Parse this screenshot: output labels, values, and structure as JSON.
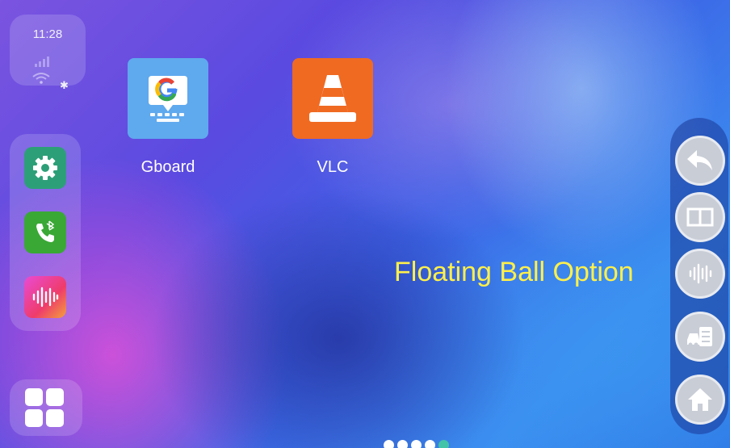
{
  "status": {
    "time": "11:28",
    "signal_icon": "signal-bars-icon",
    "wifi_icon": "wifi-icon",
    "bluetooth_icon": "bluetooth-icon"
  },
  "dock": {
    "items": [
      {
        "name": "settings",
        "icon": "gear-icon",
        "color": "#2d9f78"
      },
      {
        "name": "bluetooth-phone",
        "icon": "phone-bluetooth-icon",
        "color": "#3aa835"
      },
      {
        "name": "audio",
        "icon": "sound-wave-icon",
        "color": "#e94bd4"
      }
    ],
    "app_drawer_icon": "grid-icon"
  },
  "apps": [
    {
      "label": "Gboard",
      "icon": "gboard-icon",
      "color": "#5fa9ee"
    },
    {
      "label": "VLC",
      "icon": "vlc-cone-icon",
      "color": "#f06a22"
    }
  ],
  "caption": "Floating Ball Option",
  "floating_ball": {
    "buttons": [
      {
        "name": "back",
        "icon": "back-arrow-icon"
      },
      {
        "name": "split-screen",
        "icon": "split-screen-icon"
      },
      {
        "name": "voice",
        "icon": "sound-wave-icon"
      },
      {
        "name": "car-settings",
        "icon": "car-menu-icon"
      },
      {
        "name": "home",
        "icon": "home-icon"
      }
    ]
  },
  "page_indicator": {
    "count": 5,
    "active_color": "#43c3a8"
  }
}
